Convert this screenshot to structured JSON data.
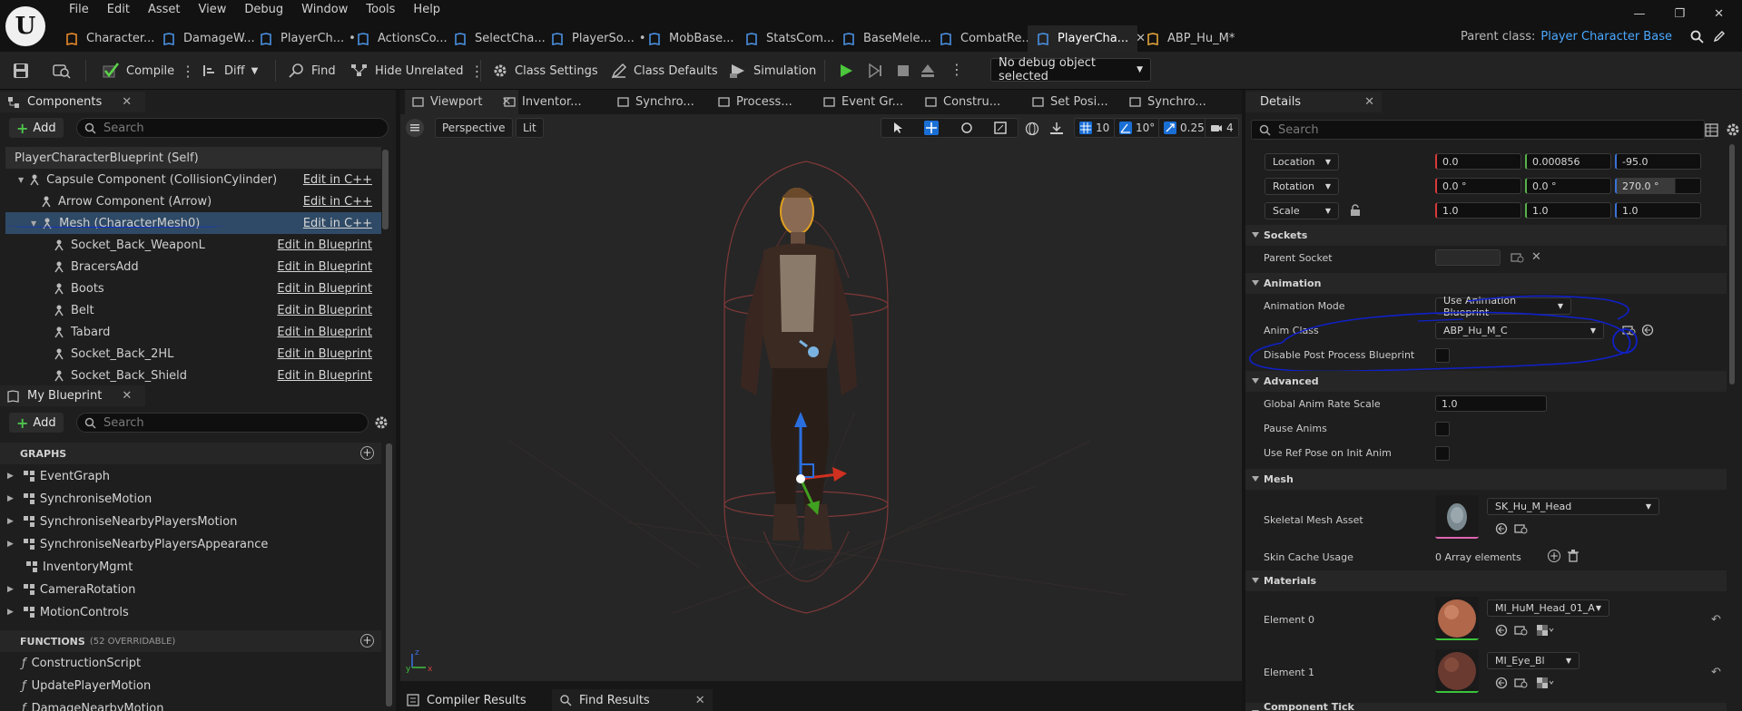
{
  "menu": [
    "File",
    "Edit",
    "Asset",
    "View",
    "Debug",
    "Window",
    "Tools",
    "Help"
  ],
  "tabs": [
    {
      "label": "Character...",
      "icon": "blueprint-icon",
      "color": "#e88a2a",
      "dirty": ""
    },
    {
      "label": "DamageW...",
      "icon": "blueprint-icon",
      "color": "#4a8fe0",
      "dirty": ""
    },
    {
      "label": "PlayerCh...",
      "icon": "blueprint-icon",
      "color": "#4a8fe0",
      "dirty": "•"
    },
    {
      "label": "ActionsCo...",
      "icon": "blueprint-icon",
      "color": "#4a8fe0",
      "dirty": ""
    },
    {
      "label": "SelectCha...",
      "icon": "blueprint-icon",
      "color": "#4a8fe0",
      "dirty": ""
    },
    {
      "label": "PlayerSo...",
      "icon": "blueprint-icon",
      "color": "#4a8fe0",
      "dirty": "•"
    },
    {
      "label": "MobBase...",
      "icon": "blueprint-icon",
      "color": "#4a8fe0",
      "dirty": ""
    },
    {
      "label": "StatsCom...",
      "icon": "blueprint-icon",
      "color": "#4a8fe0",
      "dirty": ""
    },
    {
      "label": "BaseMele...",
      "icon": "blueprint-icon",
      "color": "#4a8fe0",
      "dirty": ""
    },
    {
      "label": "CombatRe...",
      "icon": "blueprint-icon",
      "color": "#4a8fe0",
      "dirty": ""
    },
    {
      "label": "PlayerCha...",
      "icon": "blueprint-icon",
      "color": "#4a8fe0",
      "dirty": "",
      "active": true,
      "close": "✕"
    },
    {
      "label": "ABP_Hu_M*",
      "icon": "anim-icon",
      "color": "#e0a33a",
      "dirty": ""
    }
  ],
  "parent_class": {
    "label": "Parent class:",
    "value": "Player Character Base"
  },
  "toolbar": {
    "compile": "Compile",
    "diff": "Diff",
    "find": "Find",
    "hide_unrelated": "Hide Unrelated",
    "class_settings": "Class Settings",
    "class_defaults": "Class Defaults",
    "simulation": "Simulation",
    "debug_select": "No debug object selected"
  },
  "components": {
    "tab": "Components",
    "add": "Add",
    "search_placeholder": "Search",
    "rows": [
      {
        "label": "PlayerCharacterBlueprint (Self)",
        "link": ""
      },
      {
        "label": "Capsule Component (CollisionCylinder)",
        "link": "Edit in C++"
      },
      {
        "label": "Arrow Component (Arrow)",
        "link": "Edit in C++"
      },
      {
        "label": "Mesh (CharacterMesh0)",
        "link": "Edit in C++"
      },
      {
        "label": "Socket_Back_WeaponL",
        "link": "Edit in Blueprint"
      },
      {
        "label": "BracersAdd",
        "link": "Edit in Blueprint"
      },
      {
        "label": "Boots",
        "link": "Edit in Blueprint"
      },
      {
        "label": "Belt",
        "link": "Edit in Blueprint"
      },
      {
        "label": "Tabard",
        "link": "Edit in Blueprint"
      },
      {
        "label": "Socket_Back_2HL",
        "link": "Edit in Blueprint"
      },
      {
        "label": "Socket_Back_Shield",
        "link": "Edit in Blueprint"
      }
    ]
  },
  "my_blueprint": {
    "tab": "My Blueprint",
    "add": "Add",
    "search_placeholder": "Search",
    "graphs_title": "GRAPHS",
    "graphs": [
      "EventGraph",
      "SynchroniseMotion",
      "SynchroniseNearbyPlayersMotion",
      "SynchroniseNearbyPlayersAppearance",
      "InventoryMgmt",
      "CameraRotation",
      "MotionControls"
    ],
    "functions_title": "FUNCTIONS",
    "functions_note": "(52 OVERRIDABLE)",
    "functions": [
      "ConstructionScript",
      "UpdatePlayerMotion",
      "DamageNearbyMotion"
    ]
  },
  "viewport_tabs": [
    "Viewport",
    "Inventor...",
    "Synchro...",
    "Process...",
    "Event Gr...",
    "Constru...",
    "Set Posi...",
    "Synchro..."
  ],
  "viewport": {
    "perspective": "Perspective",
    "lit": "Lit",
    "grid": "10",
    "angle": "10°",
    "scale": "0.25",
    "cam": "4"
  },
  "bottom_tabs": [
    "Compiler Results",
    "Find Results"
  ],
  "details": {
    "tab": "Details",
    "search_placeholder": "Search",
    "location": {
      "label": "Location",
      "x": "0.0",
      "y": "0.000856",
      "z": "-95.0"
    },
    "rotation": {
      "label": "Rotation",
      "x": "0.0 °",
      "y": "0.0 °",
      "z": "270.0 °"
    },
    "scale": {
      "label": "Scale",
      "x": "1.0",
      "y": "1.0",
      "z": "1.0"
    },
    "sockets": "Sockets",
    "parent_socket": "Parent Socket",
    "animation": "Animation",
    "animation_mode_label": "Animation Mode",
    "animation_mode": "Use Animation Blueprint",
    "anim_class_label": "Anim Class",
    "anim_class": "ABP_Hu_M_C",
    "disable_pp": "Disable Post Process Blueprint",
    "advanced": "Advanced",
    "global_rate_label": "Global Anim Rate Scale",
    "global_rate": "1.0",
    "pause_anims": "Pause Anims",
    "ref_pose": "Use Ref Pose on Init Anim",
    "mesh": "Mesh",
    "skeletal_label": "Skeletal Mesh Asset",
    "skeletal": "SK_Hu_M_Head",
    "skin_cache_label": "Skin Cache Usage",
    "skin_cache": "0 Array elements",
    "materials": "Materials",
    "element0_label": "Element 0",
    "element0": "MI_HuM_Head_01_A",
    "element1_label": "Element 1",
    "element1": "MI_Eye_Bl",
    "component_tick": "Component Tick"
  }
}
